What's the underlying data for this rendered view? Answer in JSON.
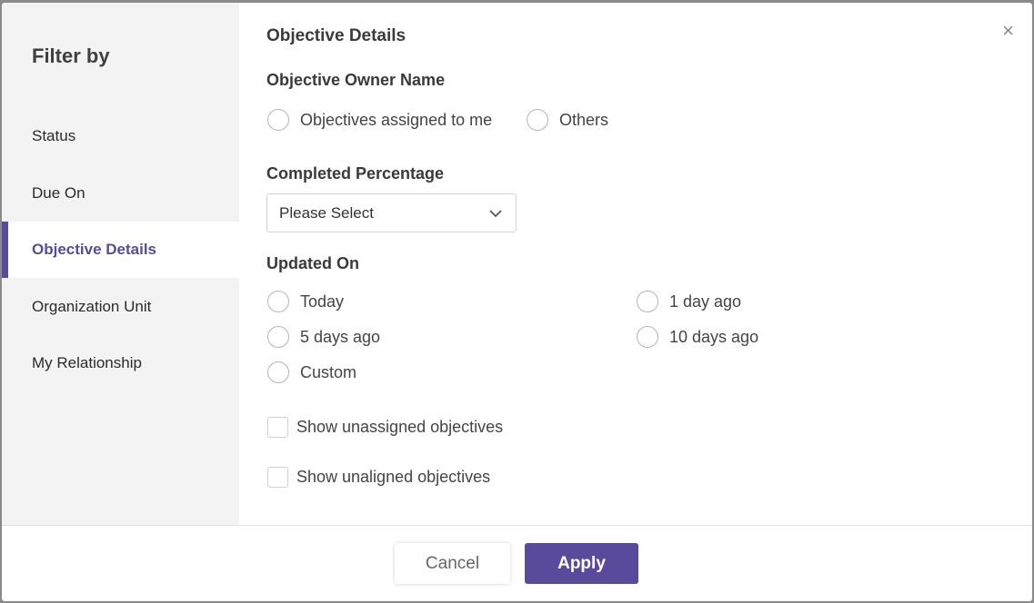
{
  "sidebar": {
    "title": "Filter by",
    "items": [
      {
        "label": "Status",
        "active": false
      },
      {
        "label": "Due On",
        "active": false
      },
      {
        "label": "Objective Details",
        "active": true
      },
      {
        "label": "Organization Unit",
        "active": false
      },
      {
        "label": "My Relationship",
        "active": false
      }
    ]
  },
  "main": {
    "title": "Objective Details",
    "owner": {
      "label": "Objective Owner Name",
      "options": [
        "Objectives assigned to me",
        "Others"
      ]
    },
    "completed": {
      "label": "Completed Percentage",
      "selected": "Please Select"
    },
    "updated": {
      "label": "Updated On",
      "options": [
        "Today",
        "1 day ago",
        "5 days ago",
        "10 days ago",
        "Custom"
      ]
    },
    "checkboxes": [
      "Show unassigned objectives",
      "Show unaligned objectives"
    ]
  },
  "footer": {
    "cancel_label": "Cancel",
    "apply_label": "Apply"
  },
  "close_symbol": "×",
  "colors": {
    "accent": "#5a4a9c",
    "sidebar_bg": "#f3f3f3"
  }
}
